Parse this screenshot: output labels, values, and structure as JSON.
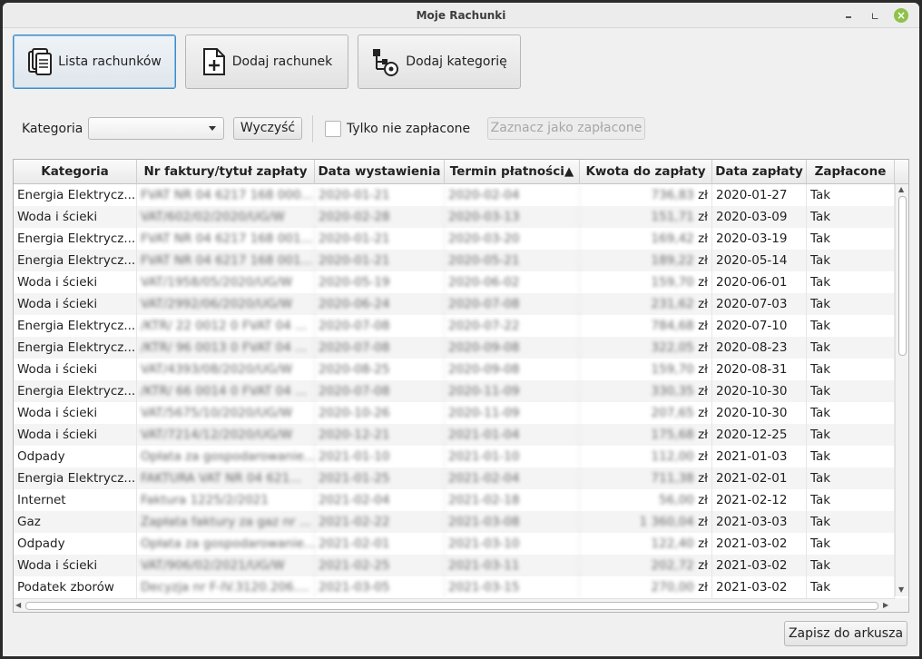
{
  "window": {
    "title": "Moje Rachunki"
  },
  "toolbar": {
    "list_label": "Lista rachunków",
    "add_bill_label": "Dodaj rachunek",
    "add_category_label": "Dodaj kategorię"
  },
  "filters": {
    "category_label": "Kategoria",
    "category_value": "",
    "clear_label": "Wyczyść",
    "unpaid_only_label": "Tylko nie zapłacone",
    "mark_paid_label": "Zaznacz jako zapłacone"
  },
  "table": {
    "columns": [
      "Kategoria",
      "Nr faktury/tytuł zapłaty",
      "Data wystawienia",
      "Termin płatności▲",
      "Kwota do zapłaty",
      "Data zapłaty",
      "Zapłacone"
    ],
    "currency": "zł",
    "rows": [
      {
        "cat": "Energia Elektrycz...",
        "nr": "FVAT NR 04 6217 168 000...",
        "issued": "2020-01-21",
        "due": "2020-02-04",
        "amount": "736,83",
        "paid_date": "2020-01-27",
        "paid": "Tak"
      },
      {
        "cat": "Woda i ścieki",
        "nr": "VAT/602/02/2020/UG/W",
        "issued": "2020-02-28",
        "due": "2020-03-13",
        "amount": "151,71",
        "paid_date": "2020-03-09",
        "paid": "Tak"
      },
      {
        "cat": "Energia Elektrycz...",
        "nr": "FVAT NR 04 6217 168 001...",
        "issued": "2020-01-21",
        "due": "2020-03-20",
        "amount": "169,42",
        "paid_date": "2020-03-19",
        "paid": "Tak"
      },
      {
        "cat": "Energia Elektrycz...",
        "nr": "FVAT NR 04 6217 168 001...",
        "issued": "2020-01-21",
        "due": "2020-05-21",
        "amount": "189,22",
        "paid_date": "2020-05-14",
        "paid": "Tak"
      },
      {
        "cat": "Woda i ścieki",
        "nr": "VAT/1958/05/2020/UG/W",
        "issued": "2020-05-19",
        "due": "2020-06-02",
        "amount": "159,70",
        "paid_date": "2020-06-01",
        "paid": "Tak"
      },
      {
        "cat": "Woda i ścieki",
        "nr": "VAT/2992/06/2020/UG/W",
        "issued": "2020-06-24",
        "due": "2020-07-08",
        "amount": "231,62",
        "paid_date": "2020-07-03",
        "paid": "Tak"
      },
      {
        "cat": "Energia Elektrycz...",
        "nr": "/KTR/ 22 0012 0 FVAT 04 ...",
        "issued": "2020-07-08",
        "due": "2020-07-22",
        "amount": "784,68",
        "paid_date": "2020-07-10",
        "paid": "Tak"
      },
      {
        "cat": "Energia Elektrycz...",
        "nr": "/KTR/ 96 0013 0 FVAT 04 ...",
        "issued": "2020-07-08",
        "due": "2020-09-08",
        "amount": "322,05",
        "paid_date": "2020-08-23",
        "paid": "Tak"
      },
      {
        "cat": "Woda i ścieki",
        "nr": "VAT/4393/08/2020/UG/W",
        "issued": "2020-08-25",
        "due": "2020-09-08",
        "amount": "159,70",
        "paid_date": "2020-08-31",
        "paid": "Tak"
      },
      {
        "cat": "Energia Elektrycz...",
        "nr": "/KTR/ 66 0014 0 FVAT 04 ...",
        "issued": "2020-07-08",
        "due": "2020-11-09",
        "amount": "330,35",
        "paid_date": "2020-10-30",
        "paid": "Tak"
      },
      {
        "cat": "Woda i ścieki",
        "nr": "VAT/5675/10/2020/UG/W",
        "issued": "2020-10-26",
        "due": "2020-11-09",
        "amount": "207,65",
        "paid_date": "2020-10-30",
        "paid": "Tak"
      },
      {
        "cat": "Woda i ścieki",
        "nr": "VAT/7214/12/2020/UG/W",
        "issued": "2020-12-21",
        "due": "2021-01-04",
        "amount": "175,68",
        "paid_date": "2020-12-25",
        "paid": "Tak"
      },
      {
        "cat": "Odpady",
        "nr": "Opłata za gospodarowanie...",
        "issued": "2021-01-10",
        "due": "2021-01-10",
        "amount": "112,00",
        "paid_date": "2021-01-03",
        "paid": "Tak"
      },
      {
        "cat": "Energia Elektrycz...",
        "nr": "FAKTURA VAT NR 04 621...",
        "issued": "2021-01-25",
        "due": "2021-02-04",
        "amount": "711,38",
        "paid_date": "2021-02-01",
        "paid": "Tak"
      },
      {
        "cat": "Internet",
        "nr": "Faktura 1225/2/2021",
        "issued": "2021-02-04",
        "due": "2021-02-18",
        "amount": "56,00",
        "paid_date": "2021-02-12",
        "paid": "Tak"
      },
      {
        "cat": "Gaz",
        "nr": "Zapłata faktury za gaz nr ...",
        "issued": "2021-02-22",
        "due": "2021-03-08",
        "amount": "1 360,04",
        "paid_date": "2021-03-03",
        "paid": "Tak"
      },
      {
        "cat": "Odpady",
        "nr": "Opłata za gospodarowanie...",
        "issued": "2021-02-01",
        "due": "2021-03-10",
        "amount": "122,40",
        "paid_date": "2021-03-02",
        "paid": "Tak"
      },
      {
        "cat": "Woda i ścieki",
        "nr": "VAT/906/02/2021/UG/W",
        "issued": "2021-02-25",
        "due": "2021-03-11",
        "amount": "202,72",
        "paid_date": "2021-03-02",
        "paid": "Tak"
      },
      {
        "cat": "Podatek zborów",
        "nr": "Decyzja nr F-IV.3120.206....",
        "issued": "2021-03-05",
        "due": "2021-03-15",
        "amount": "270,00",
        "paid_date": "2021-03-02",
        "paid": "Tak"
      }
    ]
  },
  "footer": {
    "save_label": "Zapisz do arkusza"
  }
}
